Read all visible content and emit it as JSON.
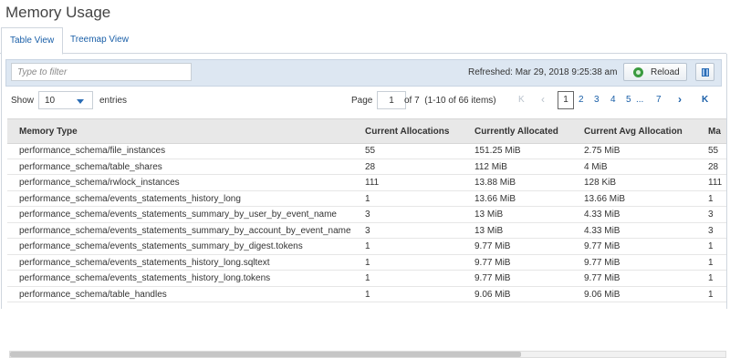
{
  "page": {
    "title": "Memory Usage"
  },
  "tabs": [
    {
      "label": "Table View",
      "active": true
    },
    {
      "label": "Treemap View",
      "active": false
    }
  ],
  "toolbar": {
    "filter_placeholder": "Type to filter",
    "refreshed": "Refreshed: Mar 29, 2018 9:25:38 am",
    "reload_label": "Reload",
    "reload_icon": "refresh-icon",
    "columns_icon": "columns-icon"
  },
  "pagination": {
    "show_label": "Show",
    "page_size": "10",
    "entries_label": "entries",
    "page_label": "Page",
    "current_page": "1",
    "of_label": "of 7",
    "range_label": "(1-10 of 66 items)",
    "first": "K",
    "prev": "‹",
    "pages": [
      "1",
      "2",
      "3",
      "4",
      "5"
    ],
    "ellipsis": "...",
    "last_page": "7",
    "next": "›",
    "last": "K"
  },
  "table": {
    "columns": [
      "Memory Type",
      "Current Allocations",
      "Currently Allocated",
      "Current Avg Allocation",
      "Ma"
    ],
    "rows": [
      [
        "performance_schema/file_instances",
        "55",
        "151.25 MiB",
        "2.75 MiB",
        "55"
      ],
      [
        "performance_schema/table_shares",
        "28",
        "112 MiB",
        "4 MiB",
        "28"
      ],
      [
        "performance_schema/rwlock_instances",
        "111",
        "13.88 MiB",
        "128 KiB",
        "111"
      ],
      [
        "performance_schema/events_statements_history_long",
        "1",
        "13.66 MiB",
        "13.66 MiB",
        "1"
      ],
      [
        "performance_schema/events_statements_summary_by_user_by_event_name",
        "3",
        "13 MiB",
        "4.33 MiB",
        "3"
      ],
      [
        "performance_schema/events_statements_summary_by_account_by_event_name",
        "3",
        "13 MiB",
        "4.33 MiB",
        "3"
      ],
      [
        "performance_schema/events_statements_summary_by_digest.tokens",
        "1",
        "9.77 MiB",
        "9.77 MiB",
        "1"
      ],
      [
        "performance_schema/events_statements_history_long.sqltext",
        "1",
        "9.77 MiB",
        "9.77 MiB",
        "1"
      ],
      [
        "performance_schema/events_statements_history_long.tokens",
        "1",
        "9.77 MiB",
        "9.77 MiB",
        "1"
      ],
      [
        "performance_schema/table_handles",
        "1",
        "9.06 MiB",
        "9.06 MiB",
        "1"
      ]
    ]
  }
}
